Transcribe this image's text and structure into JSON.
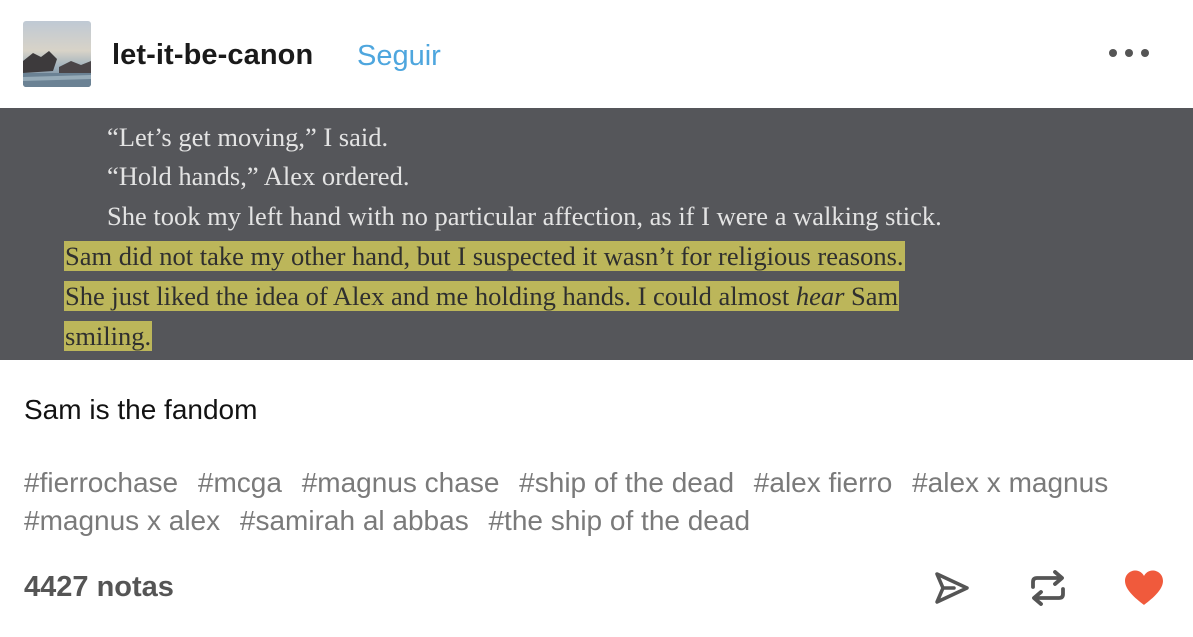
{
  "post": {
    "username": "let-it-be-canon",
    "follow_label": "Seguir",
    "more_icon": "more-horizontal-icon",
    "image": {
      "lines": [
        {
          "text": "“Let’s get moving,” I said.",
          "highlighted": false
        },
        {
          "text": "“Hold hands,” Alex ordered.",
          "highlighted": false
        },
        {
          "text": "She took my left hand with no particular affection, as if I were a walking stick.",
          "highlighted": false
        },
        {
          "text": "Sam did not take my other hand, but I suspected it wasn’t for religious reasons.",
          "highlighted": true
        },
        {
          "text": "She just liked the idea of Alex and me holding hands. I could almost hear Sam",
          "highlighted": true
        },
        {
          "text": "smiling.",
          "highlighted": true
        }
      ]
    },
    "caption": "Sam is the fandom",
    "tags": [
      "#fierrochase",
      "#mcga",
      "#magnus chase",
      "#ship of the dead",
      "#alex fierro",
      "#alex x magnus",
      "#magnus x alex",
      "#samirah al abbas",
      "#the ship of the dead"
    ],
    "notes": "4427 notas",
    "actions": {
      "share_icon": "send-icon",
      "reblog_icon": "reblog-icon",
      "like_icon": "heart-icon"
    }
  },
  "colors": {
    "follow": "#4ea6de",
    "highlight": "#bcb65a",
    "like": "#f05a3c",
    "book_background": "#55565a"
  }
}
